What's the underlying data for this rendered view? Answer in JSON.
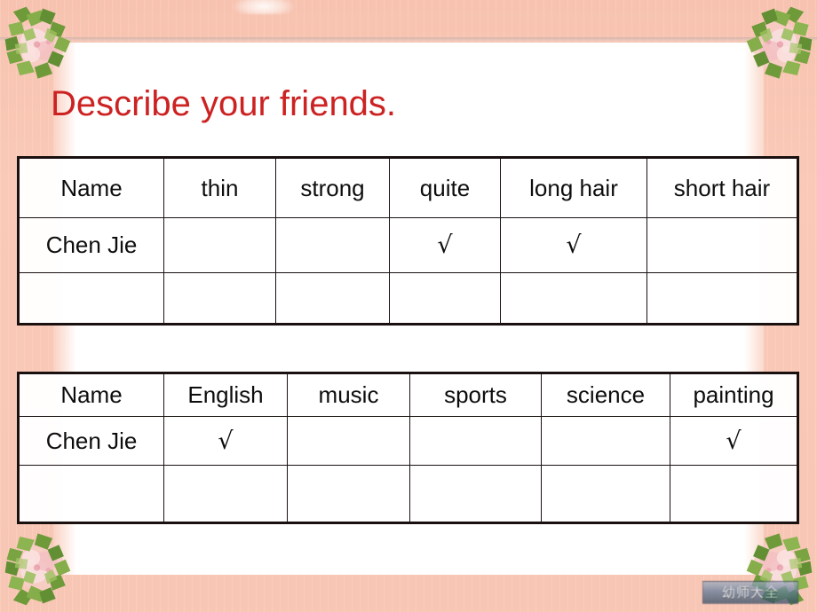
{
  "slide": {
    "title": "Describe your friends.",
    "title_color": "#cc2222",
    "frame_color": "#f8c6b4",
    "page_color": "#ffffff",
    "tick_mark": "√"
  },
  "decorations": {
    "corner_top_left": "floral-corner-icon",
    "corner_top_right": "floral-corner-icon",
    "corner_bottom_left": "floral-corner-icon",
    "corner_bottom_right": "floral-corner-icon",
    "top_center_ornament": "ribbon-ornament-icon"
  },
  "table_friends": {
    "headers": [
      "Name",
      "thin",
      "strong",
      "quite",
      "long hair",
      "short hair"
    ],
    "rows": [
      {
        "name": "Chen Jie",
        "cells": [
          "",
          "",
          "√",
          "√",
          ""
        ]
      },
      {
        "name": "",
        "cells": [
          "",
          "",
          "",
          "",
          ""
        ]
      }
    ]
  },
  "table_subjects": {
    "headers": [
      "Name",
      "English",
      "music",
      "sports",
      "science",
      "painting"
    ],
    "rows": [
      {
        "name": "Chen Jie",
        "cells": [
          "√",
          "",
          "",
          "",
          "√"
        ]
      },
      {
        "name": "",
        "cells": [
          "",
          "",
          "",
          "",
          ""
        ]
      }
    ]
  },
  "watermark": {
    "label": "幼师大全"
  }
}
